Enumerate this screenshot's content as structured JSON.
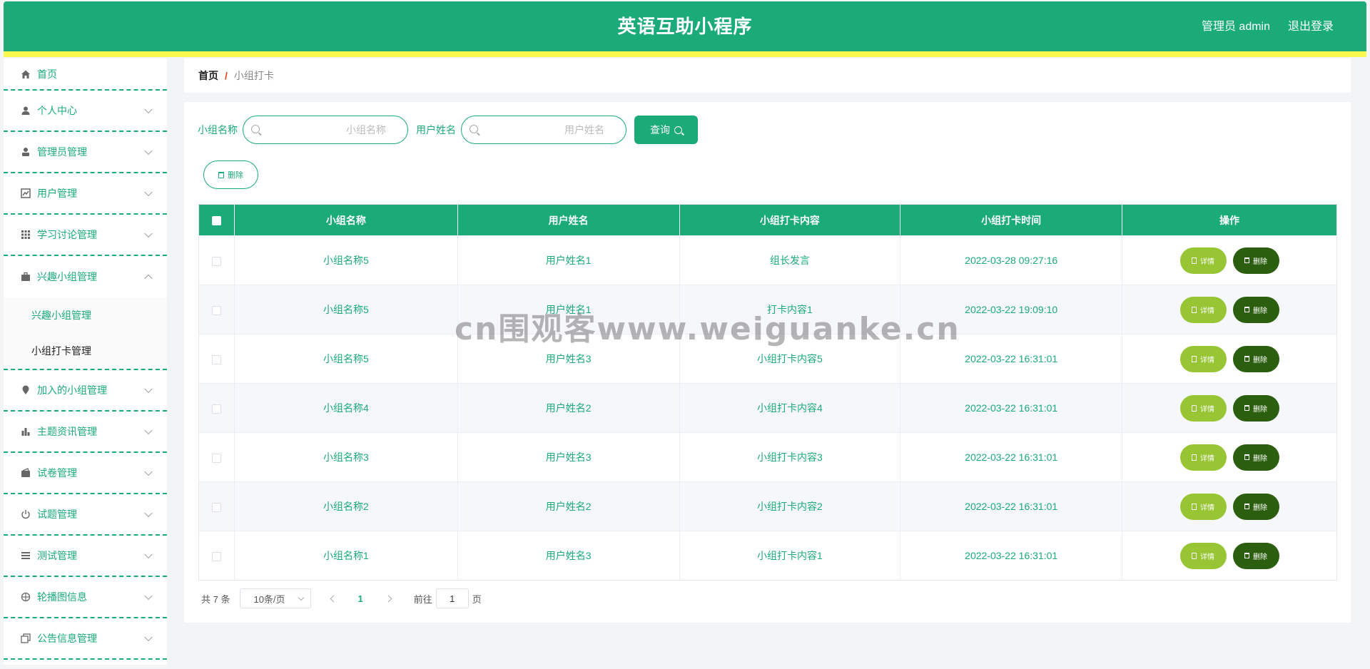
{
  "header": {
    "title": "英语互助小程序",
    "user": "管理员 admin",
    "logout": "退出登录"
  },
  "sidebar": {
    "items": [
      {
        "label": "首页",
        "icon": "home-icon"
      },
      {
        "label": "个人中心",
        "icon": "user-icon"
      },
      {
        "label": "管理员管理",
        "icon": "admin-icon"
      },
      {
        "label": "用户管理",
        "icon": "chart-icon"
      },
      {
        "label": "学习讨论管理",
        "icon": "grid-icon"
      },
      {
        "label": "兴趣小组管理",
        "icon": "briefcase-icon"
      },
      {
        "label": "加入的小组管理",
        "icon": "location-icon"
      },
      {
        "label": "主题资讯管理",
        "icon": "bar-chart-icon"
      },
      {
        "label": "试卷管理",
        "icon": "wallet-icon"
      },
      {
        "label": "试题管理",
        "icon": "power-icon"
      },
      {
        "label": "测试管理",
        "icon": "list-icon"
      },
      {
        "label": "轮播图信息",
        "icon": "target-icon"
      },
      {
        "label": "公告信息管理",
        "icon": "copy-icon"
      }
    ],
    "submenu": [
      {
        "label": "兴趣小组管理"
      },
      {
        "label": "小组打卡管理"
      }
    ]
  },
  "breadcrumb": {
    "home": "首页",
    "separator": "/",
    "current": "小组打卡"
  },
  "search": {
    "group_label": "小组名称",
    "group_placeholder": "小组名称",
    "user_label": "用户姓名",
    "user_placeholder": "用户姓名",
    "query_label": "查询"
  },
  "actions": {
    "batch_delete": "删除"
  },
  "table": {
    "headers": [
      "小组名称",
      "用户姓名",
      "小组打卡内容",
      "小组打卡时间",
      "操作"
    ],
    "detail_label": "详情",
    "delete_label": "删除",
    "rows": [
      {
        "group": "小组名称5",
        "user": "用户姓名1",
        "content": "组长发言",
        "time": "2022-03-28 09:27:16"
      },
      {
        "group": "小组名称5",
        "user": "用户姓名1",
        "content": "打卡内容1",
        "time": "2022-03-22 19:09:10"
      },
      {
        "group": "小组名称5",
        "user": "用户姓名3",
        "content": "小组打卡内容5",
        "time": "2022-03-22 16:31:01"
      },
      {
        "group": "小组名称4",
        "user": "用户姓名2",
        "content": "小组打卡内容4",
        "time": "2022-03-22 16:31:01"
      },
      {
        "group": "小组名称3",
        "user": "用户姓名3",
        "content": "小组打卡内容3",
        "time": "2022-03-22 16:31:01"
      },
      {
        "group": "小组名称2",
        "user": "用户姓名2",
        "content": "小组打卡内容2",
        "time": "2022-03-22 16:31:01"
      },
      {
        "group": "小组名称1",
        "user": "用户姓名3",
        "content": "小组打卡内容1",
        "time": "2022-03-22 16:31:01"
      }
    ]
  },
  "pagination": {
    "total": "共 7 条",
    "page_size": "10条/页",
    "current_page": "1",
    "goto_prefix": "前往",
    "goto_value": "1",
    "goto_suffix": "页"
  },
  "watermark": "cn围观客www.weiguanke.cn",
  "colors": {
    "primary": "#1aab78",
    "accent_stripe": "#f7f94c",
    "detail_button": "#98c534",
    "delete_button": "#2b5e0e",
    "breadcrumb_separator": "#e8421c"
  }
}
